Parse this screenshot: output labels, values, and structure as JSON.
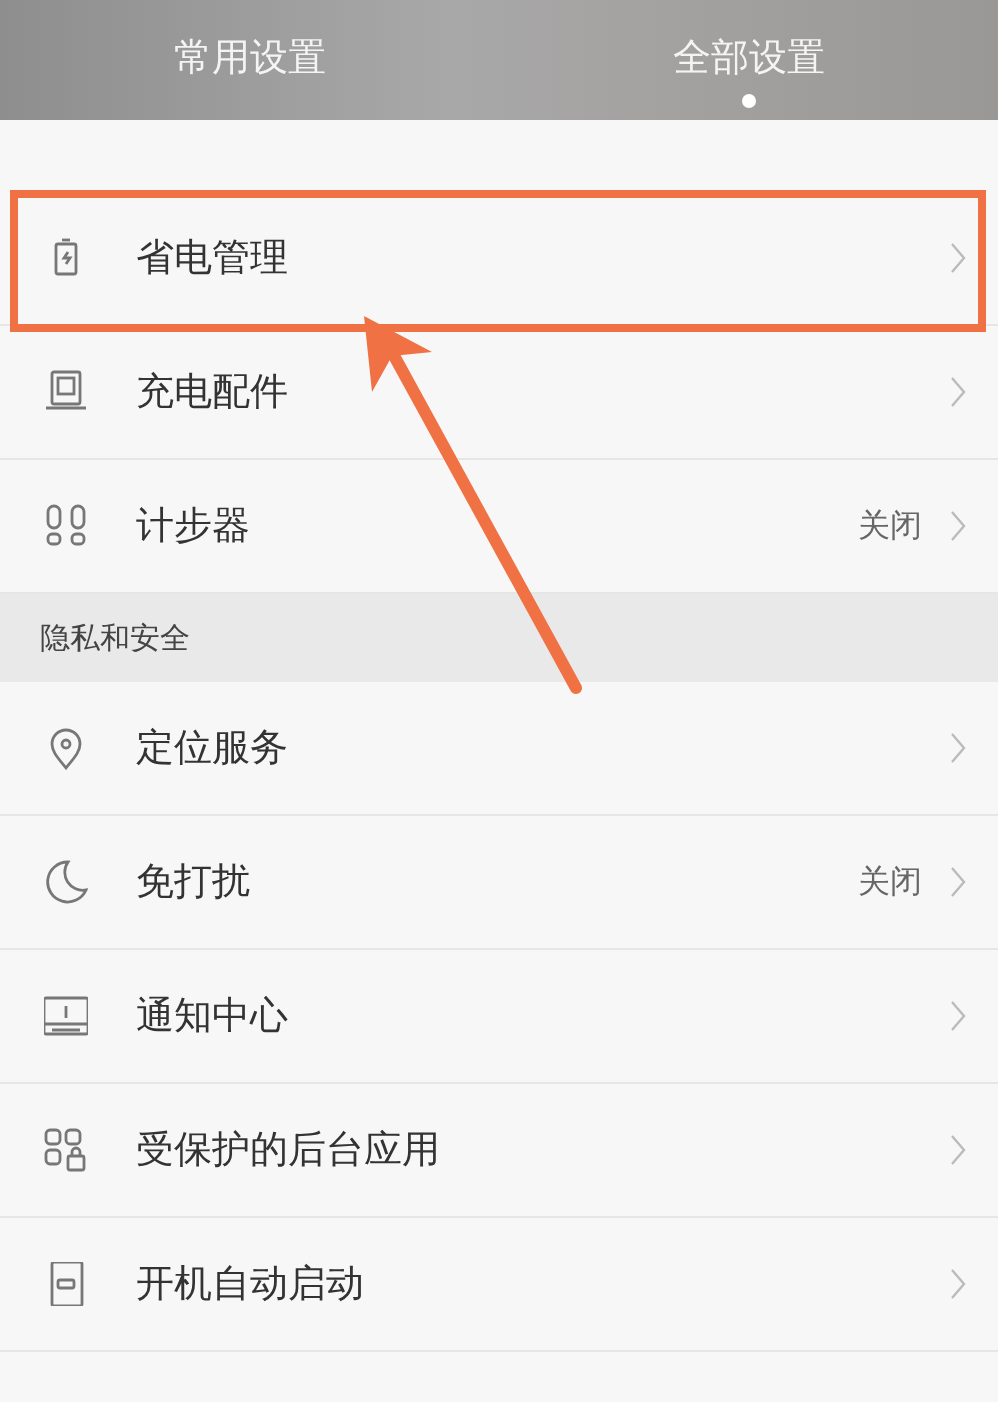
{
  "tabs": [
    {
      "label": "常用设置",
      "selected": false
    },
    {
      "label": "全部设置",
      "selected": true
    }
  ],
  "sections": [
    {
      "items": [
        {
          "label": "省电管理",
          "highlighted": true
        },
        {
          "label": "充电配件",
          "highlighted": false
        },
        {
          "label": "计步器",
          "value": "关闭",
          "highlighted": false
        }
      ]
    },
    {
      "header": "隐私和安全",
      "items": [
        {
          "label": "定位服务",
          "highlighted": false
        },
        {
          "label": "免打扰",
          "value": "关闭",
          "highlighted": false
        },
        {
          "label": "通知中心",
          "highlighted": false
        },
        {
          "label": "受保护的后台应用",
          "highlighted": false
        },
        {
          "label": "开机自动启动",
          "highlighted": false
        }
      ]
    }
  ],
  "annotation": {
    "arrow": true
  }
}
